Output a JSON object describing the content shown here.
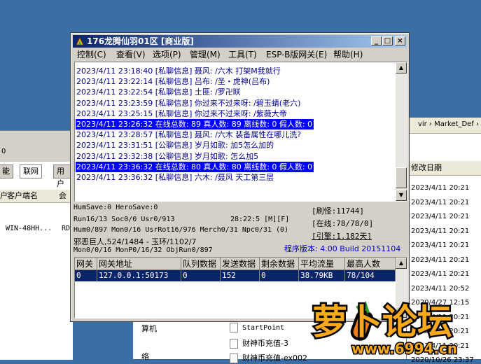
{
  "bg_left": {
    "partial_text": "0",
    "tabs": [
      "能",
      "联网",
      "用户"
    ],
    "col_headers": [
      "户",
      "客户端名",
      "会"
    ],
    "row": "WIN-48HH...",
    "row_suffix": "RD"
  },
  "bg_right": {
    "breadcrumb": "vir › Market_Def ›",
    "col_header": "修改日期",
    "dates": [
      "2023/4/11 20:21",
      "2023/4/11 20:21",
      "2023/4/11 20:21",
      "2023/4/11 20:21",
      "2023/4/11 20:21",
      "2023/4/11 20:21",
      "2023/4/11 20:21",
      "2023/4/11 20:52",
      "2020/4/27 12:15",
      "2023/4/11 20:21",
      "2023/4/11 20:21",
      "2023/4/11 20:21",
      "2020/10/26 23:37"
    ]
  },
  "bg_bottom": {
    "left_items": [
      "算机",
      "络"
    ],
    "files": [
      "StartPoint",
      "财神币充值-3",
      "财神币充值-ex002"
    ]
  },
  "window": {
    "title": "176龙腾仙羽01区 [商业版]",
    "buttons": {
      "minimize": "_",
      "maximize": "□",
      "close": "×"
    },
    "menu": [
      "控制(C)",
      "查看(V)",
      "选项(P)",
      "管理(M)",
      "工具(T)",
      "ESP-B版网关(E)",
      "帮助(H)"
    ]
  },
  "log": [
    {
      "text": "2023/4/11 23:18:40 [私聊信息] 聂风: /六木 打架M我就行",
      "highlight": false
    },
    {
      "text": "2023/4/11 23:22:14 [私聊信息] 吕布: /圣・虎神(吕布)",
      "highlight": false
    },
    {
      "text": "2023/4/11 23:22:54 [私聊信息] 土匪: /罗卍眹",
      "highlight": false
    },
    {
      "text": "2023/4/11 23:23:59 [私聊信息] 你过来不过来呀: /碧玉蜻(老六)",
      "highlight": false
    },
    {
      "text": "2023/4/11 23:25:15 [私聊信息] 你过来不过来呀: /紫薇大帝",
      "highlight": false
    },
    {
      "text": "2023/4/11 23:26:32 在线总数: 89 真人数: 89 离线数: 0 假人数: 0",
      "highlight": true
    },
    {
      "text": "2023/4/11 23:28:57 [私聊信息] 聂风: /六木 装备属性在哪儿洗?",
      "highlight": false
    },
    {
      "text": "2023/4/11 23:31:51 [公聊信息] 岁月如歌: 加5怎么加的",
      "highlight": false
    },
    {
      "text": "2023/4/11 23:32:38 [公聊信息] 岁月如歌: 怎么加5",
      "highlight": false
    },
    {
      "text": "2023/4/11 23:36:32 在线总数: 80 真人数: 80 离线数: 0 假人数: 0",
      "highlight": true
    },
    {
      "text": "2023/4/11 23:36:32 [私聊信息] 六木: /聂风 天工第三层",
      "highlight": false
    }
  ],
  "stats": {
    "humsave": "HumSave:0 HeroSave:0",
    "refresh": "[刷怪:11744]",
    "run": "Run16/13 Soc0/0 Usr0/913",
    "time": "28:22:5 [M][F]",
    "online": "[在线:78/78/0]",
    "hum": "Hum0/897 Mon0/16 UsrRot16/976 Merch0/31 Npc0/31 (0)",
    "quote": "[引擎:1.182天]",
    "boss": "邪恶巨人,524/1484 - 玉环/1102/7",
    "version": "程序版本: 4.00 Build 20151104",
    "mon": "Mon0/0/16 MonP0/16/32 ObjRun0/897"
  },
  "gateway_table": {
    "headers": [
      "网关",
      "网关地址",
      "队列数据",
      "发送数据",
      "剩余数据",
      "平均流量",
      "最高人数"
    ],
    "rows": [
      [
        "0",
        "127.0.0.1:50173",
        "0",
        "152",
        "0",
        "38.79KB",
        "78/104"
      ]
    ]
  },
  "watermark": {
    "logo_text": "萝卜论坛",
    "url": "www.6994.cn"
  }
}
